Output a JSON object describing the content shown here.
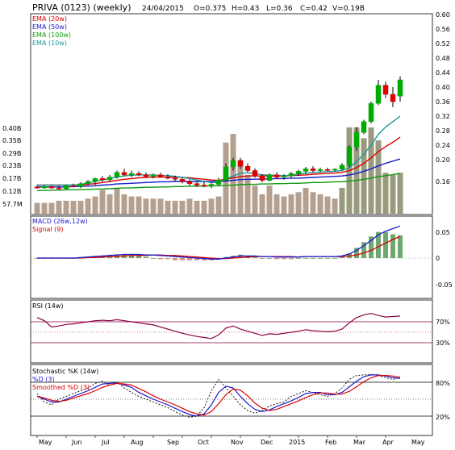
{
  "header": {
    "symbol": "PRIVA (0123) (weekly)",
    "date": "24/04/2015",
    "open": "O=0.375",
    "high": "H=0.43",
    "low": "L=0.36",
    "close": "C=0.42",
    "volume": "V=0.19B"
  },
  "colors": {
    "up": "#00aa00",
    "down": "#dd0000",
    "ema20": "#dd0000",
    "ema50": "#1a1acc",
    "ema100": "#119911",
    "ema10": "#1a9999",
    "volume": "#b5a08f",
    "volume_recent": "#9a9a7e",
    "macd": "#1a1acc",
    "signal": "#dd0000",
    "rsi": "#8b0040",
    "stoch_k": "#000000",
    "stoch_d": "#1a1acc",
    "smoothed_d": "#dd0000"
  },
  "chart_data": [
    {
      "type": "candlestick",
      "name": "price",
      "legend": [
        "EMA (20w)",
        "EMA (50w)",
        "EMA (100w)",
        "EMA (10w)"
      ],
      "y_ticks": [
        "0.60",
        "0.56",
        "0.52",
        "0.48",
        "0.44",
        "0.40",
        "0.36",
        "0.32",
        "0.28",
        "0.24",
        "0.20",
        "0.16"
      ],
      "ylim": [
        0.1,
        0.6
      ],
      "volume_ticks": [
        "0.40B",
        "0.35B",
        "0.29B",
        "0.23B",
        "0.17B",
        "0.12B",
        "57.7M"
      ],
      "x_labels": [
        "May",
        "Jun",
        "Jul",
        "Aug",
        "Sep",
        "Oct",
        "Nov",
        "Dec",
        "2015",
        "Feb",
        "Mar",
        "Apr",
        "May"
      ],
      "weeks": [
        {
          "o": 0.125,
          "h": 0.13,
          "l": 0.12,
          "c": 0.122
        },
        {
          "o": 0.122,
          "h": 0.13,
          "l": 0.12,
          "c": 0.126
        },
        {
          "o": 0.126,
          "h": 0.13,
          "l": 0.12,
          "c": 0.122
        },
        {
          "o": 0.122,
          "h": 0.128,
          "l": 0.118,
          "c": 0.12
        },
        {
          "o": 0.12,
          "h": 0.13,
          "l": 0.118,
          "c": 0.128
        },
        {
          "o": 0.128,
          "h": 0.134,
          "l": 0.124,
          "c": 0.126
        },
        {
          "o": 0.126,
          "h": 0.138,
          "l": 0.122,
          "c": 0.134
        },
        {
          "o": 0.134,
          "h": 0.144,
          "l": 0.13,
          "c": 0.14
        },
        {
          "o": 0.14,
          "h": 0.15,
          "l": 0.13,
          "c": 0.148
        },
        {
          "o": 0.148,
          "h": 0.155,
          "l": 0.14,
          "c": 0.145
        },
        {
          "o": 0.145,
          "h": 0.158,
          "l": 0.14,
          "c": 0.152
        },
        {
          "o": 0.152,
          "h": 0.17,
          "l": 0.148,
          "c": 0.165
        },
        {
          "o": 0.165,
          "h": 0.175,
          "l": 0.155,
          "c": 0.158
        },
        {
          "o": 0.158,
          "h": 0.17,
          "l": 0.152,
          "c": 0.162
        },
        {
          "o": 0.162,
          "h": 0.168,
          "l": 0.155,
          "c": 0.158
        },
        {
          "o": 0.158,
          "h": 0.165,
          "l": 0.15,
          "c": 0.154
        },
        {
          "o": 0.154,
          "h": 0.162,
          "l": 0.148,
          "c": 0.158
        },
        {
          "o": 0.158,
          "h": 0.164,
          "l": 0.15,
          "c": 0.152
        },
        {
          "o": 0.152,
          "h": 0.16,
          "l": 0.146,
          "c": 0.149
        },
        {
          "o": 0.149,
          "h": 0.156,
          "l": 0.14,
          "c": 0.146
        },
        {
          "o": 0.146,
          "h": 0.15,
          "l": 0.135,
          "c": 0.14
        },
        {
          "o": 0.14,
          "h": 0.146,
          "l": 0.128,
          "c": 0.134
        },
        {
          "o": 0.134,
          "h": 0.14,
          "l": 0.125,
          "c": 0.13
        },
        {
          "o": 0.13,
          "h": 0.14,
          "l": 0.124,
          "c": 0.127
        },
        {
          "o": 0.127,
          "h": 0.136,
          "l": 0.122,
          "c": 0.132
        },
        {
          "o": 0.132,
          "h": 0.15,
          "l": 0.128,
          "c": 0.144
        },
        {
          "o": 0.144,
          "h": 0.19,
          "l": 0.14,
          "c": 0.18
        },
        {
          "o": 0.18,
          "h": 0.205,
          "l": 0.17,
          "c": 0.198
        },
        {
          "o": 0.198,
          "h": 0.205,
          "l": 0.175,
          "c": 0.182
        },
        {
          "o": 0.182,
          "h": 0.19,
          "l": 0.165,
          "c": 0.17
        },
        {
          "o": 0.17,
          "h": 0.176,
          "l": 0.15,
          "c": 0.155
        },
        {
          "o": 0.155,
          "h": 0.16,
          "l": 0.138,
          "c": 0.143
        },
        {
          "o": 0.143,
          "h": 0.162,
          "l": 0.14,
          "c": 0.158
        },
        {
          "o": 0.158,
          "h": 0.165,
          "l": 0.148,
          "c": 0.152
        },
        {
          "o": 0.152,
          "h": 0.16,
          "l": 0.145,
          "c": 0.155
        },
        {
          "o": 0.155,
          "h": 0.166,
          "l": 0.15,
          "c": 0.162
        },
        {
          "o": 0.162,
          "h": 0.172,
          "l": 0.155,
          "c": 0.168
        },
        {
          "o": 0.168,
          "h": 0.18,
          "l": 0.16,
          "c": 0.175
        },
        {
          "o": 0.175,
          "h": 0.182,
          "l": 0.165,
          "c": 0.17
        },
        {
          "o": 0.17,
          "h": 0.178,
          "l": 0.165,
          "c": 0.173
        },
        {
          "o": 0.173,
          "h": 0.178,
          "l": 0.168,
          "c": 0.172
        },
        {
          "o": 0.172,
          "h": 0.176,
          "l": 0.168,
          "c": 0.174
        },
        {
          "o": 0.174,
          "h": 0.19,
          "l": 0.17,
          "c": 0.185
        },
        {
          "o": 0.185,
          "h": 0.24,
          "l": 0.18,
          "c": 0.235
        },
        {
          "o": 0.235,
          "h": 0.29,
          "l": 0.225,
          "c": 0.275
        },
        {
          "o": 0.275,
          "h": 0.31,
          "l": 0.27,
          "c": 0.305
        },
        {
          "o": 0.305,
          "h": 0.36,
          "l": 0.3,
          "c": 0.355
        },
        {
          "o": 0.355,
          "h": 0.42,
          "l": 0.35,
          "c": 0.405
        },
        {
          "o": 0.405,
          "h": 0.415,
          "l": 0.37,
          "c": 0.38
        },
        {
          "o": 0.38,
          "h": 0.4,
          "l": 0.345,
          "c": 0.36
        },
        {
          "o": 0.375,
          "h": 0.43,
          "l": 0.36,
          "c": 0.42
        }
      ],
      "volume_b": [
        0.05,
        0.05,
        0.05,
        0.06,
        0.06,
        0.06,
        0.06,
        0.07,
        0.08,
        0.11,
        0.09,
        0.12,
        0.09,
        0.08,
        0.08,
        0.07,
        0.07,
        0.07,
        0.06,
        0.06,
        0.06,
        0.07,
        0.06,
        0.06,
        0.07,
        0.08,
        0.33,
        0.37,
        0.24,
        0.18,
        0.13,
        0.09,
        0.13,
        0.09,
        0.08,
        0.09,
        0.1,
        0.12,
        0.1,
        0.09,
        0.08,
        0.07,
        0.12,
        0.4,
        0.4,
        0.35,
        0.4,
        0.34,
        0.19,
        0.18,
        0.19
      ],
      "ema10": [
        0.13,
        0.13,
        0.13,
        0.13,
        0.13,
        0.13,
        0.132,
        0.136,
        0.14,
        0.144,
        0.148,
        0.152,
        0.155,
        0.157,
        0.158,
        0.158,
        0.158,
        0.157,
        0.156,
        0.154,
        0.151,
        0.148,
        0.144,
        0.14,
        0.137,
        0.138,
        0.146,
        0.155,
        0.162,
        0.164,
        0.162,
        0.158,
        0.158,
        0.157,
        0.156,
        0.157,
        0.16,
        0.163,
        0.165,
        0.166,
        0.167,
        0.168,
        0.17,
        0.178,
        0.195,
        0.215,
        0.24,
        0.27,
        0.29,
        0.305,
        0.32
      ],
      "ema20": [
        0.13,
        0.13,
        0.13,
        0.13,
        0.13,
        0.13,
        0.13,
        0.132,
        0.134,
        0.137,
        0.14,
        0.143,
        0.146,
        0.148,
        0.15,
        0.151,
        0.152,
        0.152,
        0.152,
        0.152,
        0.151,
        0.15,
        0.148,
        0.146,
        0.144,
        0.143,
        0.146,
        0.15,
        0.153,
        0.155,
        0.155,
        0.155,
        0.155,
        0.155,
        0.155,
        0.156,
        0.157,
        0.158,
        0.16,
        0.161,
        0.162,
        0.163,
        0.165,
        0.17,
        0.178,
        0.19,
        0.205,
        0.222,
        0.236,
        0.248,
        0.262
      ],
      "ema50": [
        0.125,
        0.125,
        0.125,
        0.125,
        0.125,
        0.126,
        0.126,
        0.127,
        0.128,
        0.13,
        0.131,
        0.133,
        0.134,
        0.135,
        0.136,
        0.137,
        0.138,
        0.139,
        0.139,
        0.14,
        0.14,
        0.14,
        0.14,
        0.14,
        0.14,
        0.14,
        0.141,
        0.143,
        0.145,
        0.146,
        0.146,
        0.147,
        0.147,
        0.148,
        0.148,
        0.149,
        0.149,
        0.15,
        0.151,
        0.152,
        0.153,
        0.154,
        0.155,
        0.158,
        0.162,
        0.168,
        0.175,
        0.183,
        0.19,
        0.196,
        0.202
      ],
      "ema100": [
        0.115,
        0.115,
        0.116,
        0.116,
        0.117,
        0.117,
        0.118,
        0.118,
        0.119,
        0.119,
        0.12,
        0.121,
        0.122,
        0.122,
        0.123,
        0.124,
        0.124,
        0.125,
        0.125,
        0.126,
        0.126,
        0.127,
        0.127,
        0.127,
        0.128,
        0.128,
        0.129,
        0.13,
        0.131,
        0.132,
        0.132,
        0.133,
        0.133,
        0.134,
        0.134,
        0.135,
        0.135,
        0.136,
        0.137,
        0.137,
        0.138,
        0.139,
        0.139,
        0.141,
        0.143,
        0.146,
        0.149,
        0.153,
        0.156,
        0.159,
        0.162
      ]
    },
    {
      "type": "line",
      "name": "macd",
      "legend": [
        "MACD (26w,12w)",
        "Signal (9)"
      ],
      "y_ticks": [
        "0.05",
        "0",
        "-0.05"
      ],
      "ylim": [
        -0.075,
        0.075
      ],
      "macd": [
        0,
        0,
        0,
        0,
        0,
        0,
        0.001,
        0.002,
        0.003,
        0.004,
        0.005,
        0.006,
        0.007,
        0.007,
        0.007,
        0.006,
        0.006,
        0.005,
        0.004,
        0.003,
        0.002,
        0.001,
        0,
        -0.001,
        -0.002,
        -0.002,
        0,
        0.002,
        0.004,
        0.004,
        0.004,
        0.003,
        0.003,
        0.002,
        0.002,
        0.002,
        0.002,
        0.003,
        0.003,
        0.003,
        0.003,
        0.003,
        0.004,
        0.008,
        0.015,
        0.024,
        0.034,
        0.045,
        0.052,
        0.057,
        0.062
      ],
      "signal": [
        0,
        0,
        0,
        0,
        0,
        0,
        0,
        0.001,
        0.001,
        0.002,
        0.003,
        0.003,
        0.004,
        0.005,
        0.005,
        0.005,
        0.006,
        0.006,
        0.005,
        0.005,
        0.004,
        0.003,
        0.002,
        0.001,
        0,
        -0.001,
        -0.001,
        0,
        0.001,
        0.002,
        0.003,
        0.003,
        0.003,
        0.003,
        0.003,
        0.003,
        0.002,
        0.003,
        0.003,
        0.003,
        0.003,
        0.003,
        0.003,
        0.004,
        0.006,
        0.01,
        0.015,
        0.022,
        0.029,
        0.036,
        0.042
      ]
    },
    {
      "type": "line",
      "name": "rsi",
      "legend": [
        "RSI (14w)"
      ],
      "y_ticks": [
        "70%",
        "30%"
      ],
      "ylim": [
        0,
        100
      ],
      "rsi": [
        78,
        72,
        60,
        62,
        65,
        66,
        68,
        70,
        72,
        73,
        72,
        74,
        72,
        70,
        68,
        66,
        64,
        60,
        56,
        52,
        48,
        45,
        42,
        40,
        38,
        45,
        58,
        62,
        56,
        52,
        48,
        44,
        47,
        46,
        48,
        50,
        52,
        55,
        53,
        52,
        51,
        52,
        56,
        68,
        78,
        83,
        86,
        82,
        79,
        80,
        81
      ]
    },
    {
      "type": "line",
      "name": "stochastic",
      "legend": [
        "Stochastic %K (14w)",
        "%D (3)",
        "Smoothed %D (3)"
      ],
      "y_ticks": [
        "80%",
        "20%"
      ],
      "ylim": [
        0,
        100
      ],
      "k": [
        60,
        45,
        40,
        50,
        55,
        60,
        65,
        70,
        78,
        82,
        75,
        80,
        70,
        62,
        55,
        50,
        45,
        40,
        35,
        28,
        22,
        18,
        20,
        35,
        65,
        85,
        70,
        55,
        40,
        30,
        25,
        30,
        38,
        42,
        45,
        55,
        60,
        65,
        62,
        58,
        55,
        60,
        70,
        85,
        92,
        93,
        94,
        92,
        88,
        85,
        88
      ],
      "d": [
        55,
        50,
        45,
        45,
        50,
        55,
        60,
        65,
        71,
        77,
        78,
        79,
        75,
        71,
        62,
        56,
        50,
        45,
        40,
        34,
        28,
        23,
        20,
        24,
        40,
        62,
        73,
        70,
        55,
        42,
        32,
        28,
        31,
        37,
        42,
        47,
        53,
        60,
        62,
        62,
        58,
        58,
        62,
        72,
        82,
        90,
        93,
        93,
        91,
        88,
        87
      ],
      "sd": [
        55,
        52,
        48,
        46,
        48,
        52,
        56,
        60,
        65,
        71,
        75,
        78,
        77,
        75,
        69,
        63,
        56,
        50,
        45,
        40,
        34,
        28,
        24,
        22,
        28,
        42,
        58,
        68,
        66,
        56,
        43,
        34,
        30,
        32,
        37,
        42,
        47,
        53,
        58,
        61,
        61,
        59,
        59,
        64,
        72,
        81,
        88,
        92,
        92,
        91,
        89
      ]
    }
  ]
}
